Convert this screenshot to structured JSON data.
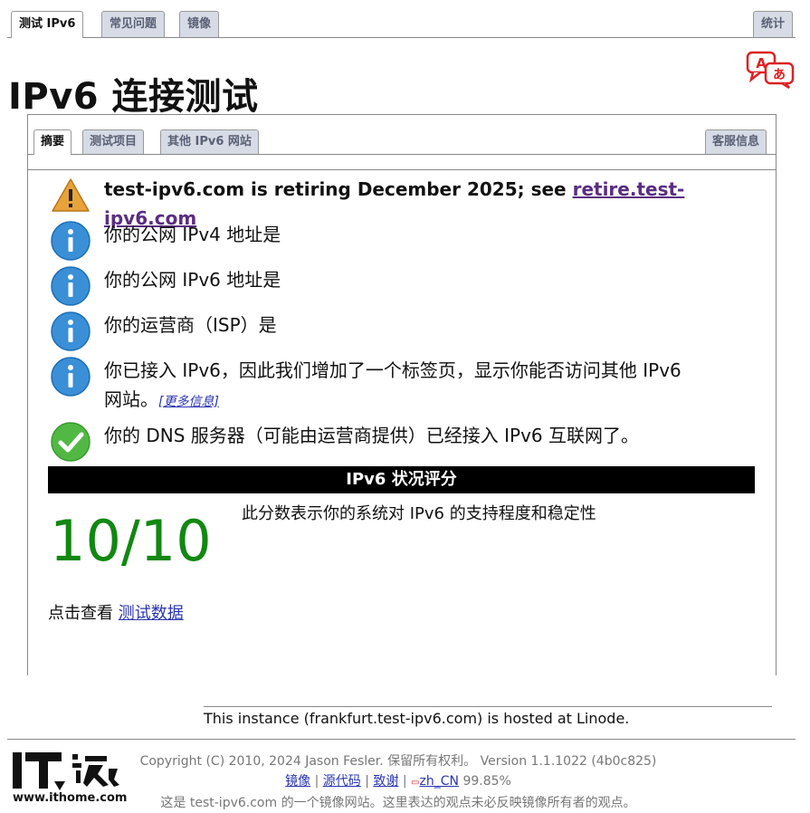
{
  "top_tabs": [
    {
      "label": "测试 IPv6",
      "active": true
    },
    {
      "label": "常见问题",
      "active": false
    },
    {
      "label": "镜像",
      "active": false
    },
    {
      "label": "统计",
      "active": false
    }
  ],
  "page_title": "IPv6 连接测试",
  "sub_tabs": [
    {
      "label": "摘要",
      "active": true
    },
    {
      "label": "测试项目",
      "active": false
    },
    {
      "label": "其他 IPv6 网站",
      "active": false
    },
    {
      "label": "客服信息",
      "active": false
    }
  ],
  "messages": {
    "warning_prefix": "test-ipv6.com is retiring December 2025; see ",
    "warning_link": "retire.test-ipv6.com",
    "ipv4": "你的公网 IPv4 地址是",
    "ipv6": "你的公网 IPv6 地址是",
    "isp": "你的运营商（ISP）是",
    "has_ipv6_line1": "你已接入 IPv6，因此我们增加了一个标签页，显示你能否访问其他 IPv6",
    "has_ipv6_line2": "网站。",
    "more_info": "[更多信息]",
    "dns": "你的 DNS 服务器（可能由运营商提供）已经接入 IPv6 互联网了。"
  },
  "score": {
    "header": "IPv6 状况评分",
    "description": "此分数表示你的系统对 IPv6 的支持程度和稳定性",
    "value": "10/10",
    "color": "#118811"
  },
  "test_data": {
    "prefix": "点击查看",
    "link": "测试数据"
  },
  "hosted": "This instance (frankfurt.test-ipv6.com) is hosted at Linode.",
  "footer": {
    "copyright": "Copyright (C) 2010, 2024 Jason Fesler. 保留所有权利。 Version 1.1.1022 (4b0c825)",
    "links": [
      "镜像",
      "源代码",
      "致谢"
    ],
    "locale": "zh_CN",
    "locale_pct": "99.85%",
    "mirror_note": "这是 test-ipv6.com 的一个镜像网站。这里表达的观点未必反映镜像所有者的观点。"
  },
  "logo": {
    "text": "IT之家",
    "url": "www.ithome.com"
  },
  "icons": {
    "warning": "warning-triangle-icon",
    "info": "info-circle-icon",
    "ok": "check-circle-icon",
    "translate": "translate-icon"
  }
}
